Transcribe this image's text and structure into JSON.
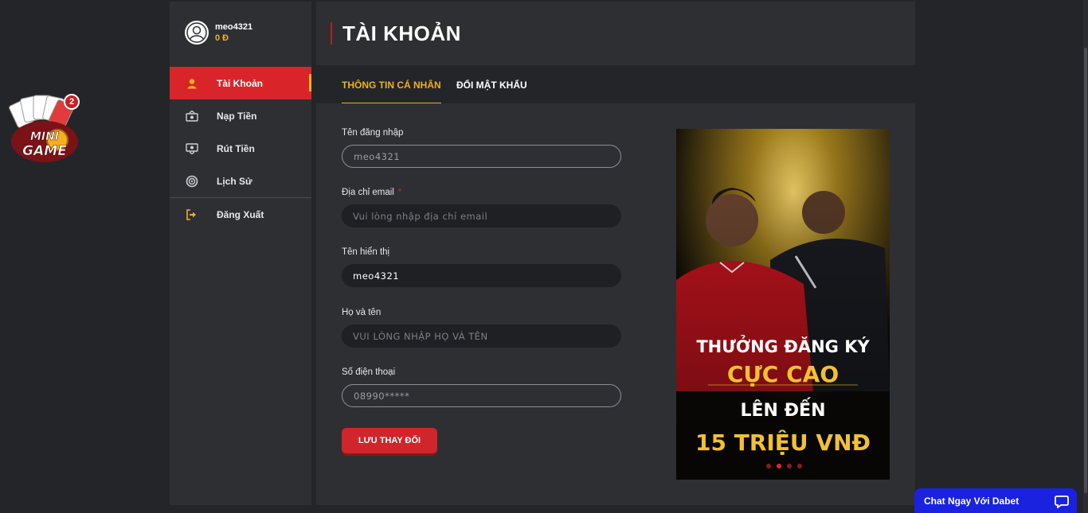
{
  "user": {
    "name": "meo4321",
    "balance": "0 Đ"
  },
  "minigame": {
    "badge": "2",
    "label": "MINI GAME"
  },
  "menu": [
    {
      "label": "Tài Khoản",
      "icon": "user-icon",
      "active": true
    },
    {
      "label": "Nạp Tiền",
      "icon": "deposit-icon",
      "active": false
    },
    {
      "label": "Rút Tiền",
      "icon": "withdraw-icon",
      "active": false
    },
    {
      "label": "Lịch Sử",
      "icon": "history-icon",
      "active": false
    },
    {
      "label": "Đăng Xuất",
      "icon": "logout-icon",
      "active": false
    }
  ],
  "header": {
    "title": "TÀI KHOẢN"
  },
  "tabs": [
    {
      "label": "THÔNG TIN CÁ NHÂN",
      "active": true
    },
    {
      "label": "ĐỔI MẬT KHẨU",
      "active": false
    }
  ],
  "form": {
    "username": {
      "label": "Tên đăng nhập",
      "value": "meo4321"
    },
    "email": {
      "label": "Địa chỉ email",
      "required_mark": "*",
      "placeholder": "Vui lòng nhập địa chỉ email"
    },
    "display_name": {
      "label": "Tên hiển thị",
      "value": "meo4321"
    },
    "full_name": {
      "label": "Họ và tên",
      "placeholder": "VUI LÒNG NHẬP HỌ VÀ TÊN"
    },
    "phone": {
      "label": "Số điện thoại",
      "value": "08990*****"
    },
    "save_label": "LƯU THAY ĐỔI"
  },
  "banner": {
    "line1": "THƯỞNG ĐĂNG KÝ",
    "line2": "CỰC CAO",
    "line3": "LÊN ĐẾN",
    "line4": "15 TRIỆU VNĐ",
    "slides": 4,
    "active_slide": 2
  },
  "chat": {
    "label": "Chat Ngay Với Dabet"
  },
  "colors": {
    "accent_red": "#d9252a",
    "accent_gold": "#f2b01e",
    "panel": "#2d2f33",
    "background": "#232529",
    "chat_blue": "#1a22e0"
  }
}
